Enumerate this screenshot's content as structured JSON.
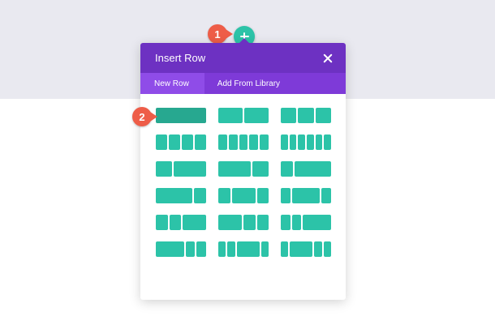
{
  "callouts": {
    "step1": "1",
    "step2": "2"
  },
  "modal": {
    "title": "Insert Row",
    "tabs": [
      {
        "label": "New Row",
        "active": true
      },
      {
        "label": "Add From Library",
        "active": false
      }
    ]
  },
  "layouts": [
    {
      "name": "one-column",
      "columns": [
        1
      ]
    },
    {
      "name": "two-columns",
      "columns": [
        1,
        1
      ]
    },
    {
      "name": "three-columns",
      "columns": [
        1,
        1,
        1
      ]
    },
    {
      "name": "four-columns",
      "columns": [
        1,
        1,
        1,
        1
      ]
    },
    {
      "name": "five-columns",
      "columns": [
        1,
        1,
        1,
        1,
        1
      ]
    },
    {
      "name": "six-columns",
      "columns": [
        1,
        1,
        1,
        1,
        1,
        1
      ]
    },
    {
      "name": "one-third-two-thirds",
      "columns": [
        1,
        2
      ]
    },
    {
      "name": "two-thirds-one-third",
      "columns": [
        2,
        1
      ]
    },
    {
      "name": "one-quarter-three-quarters",
      "columns": [
        1,
        3
      ]
    },
    {
      "name": "three-quarters-one-quarter",
      "columns": [
        3,
        1
      ]
    },
    {
      "name": "quarter-half-quarter",
      "columns": [
        1,
        2,
        1
      ]
    },
    {
      "name": "fifth-three-fifths-fifth",
      "columns": [
        1,
        3,
        1
      ]
    },
    {
      "name": "quarter-quarter-half",
      "columns": [
        1,
        1,
        2
      ]
    },
    {
      "name": "half-quarter-quarter",
      "columns": [
        2,
        1,
        1
      ]
    },
    {
      "name": "fifth-fifth-three-fifths",
      "columns": [
        1,
        1,
        3
      ]
    },
    {
      "name": "three-fifths-fifth-fifth",
      "columns": [
        3,
        1,
        1
      ]
    },
    {
      "name": "sixth-sixth-half-sixth",
      "columns": [
        1,
        1,
        3,
        1
      ]
    },
    {
      "name": "sixth-half-sixth-sixth",
      "columns": [
        1,
        3,
        1,
        1
      ]
    }
  ],
  "selected_layout_index": 0
}
